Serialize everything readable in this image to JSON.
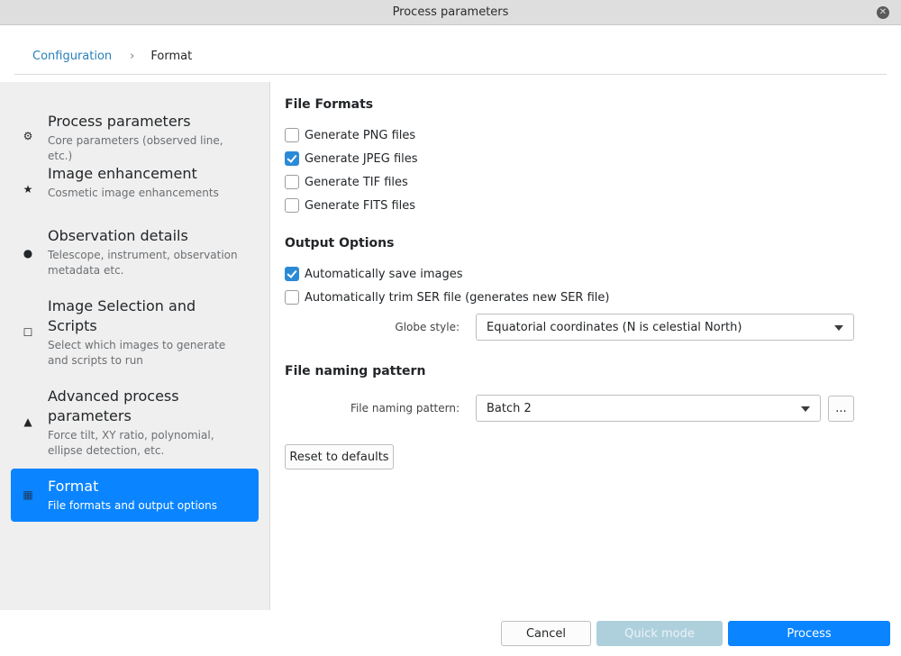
{
  "window": {
    "title": "Process parameters"
  },
  "breadcrumb": {
    "link": "Configuration",
    "separator": "›",
    "current": "Format"
  },
  "sidebar": {
    "items": [
      {
        "icon": "⚙",
        "label": "Process parameters",
        "desc": "Core parameters (observed line, etc.)"
      },
      {
        "icon": "★",
        "label": "Image enhancement",
        "desc": "Cosmetic image enhancements"
      },
      {
        "icon": "●",
        "label": "Observation details",
        "desc": "Telescope, instrument, observation metadata etc."
      },
      {
        "icon": "☐",
        "label": "Image Selection and Scripts",
        "desc": "Select which images to generate and scripts to run"
      },
      {
        "icon": "▲",
        "label": "Advanced process parameters",
        "desc": "Force tilt, XY ratio, polynomial, ellipse detection, etc."
      },
      {
        "icon": "▦",
        "label": "Format",
        "desc": "File formats and output options",
        "active": true
      }
    ]
  },
  "file_formats": {
    "title": "File Formats",
    "options": [
      {
        "label": "Generate PNG files",
        "checked": false
      },
      {
        "label": "Generate JPEG files",
        "checked": true
      },
      {
        "label": "Generate TIF files",
        "checked": false
      },
      {
        "label": "Generate FITS files",
        "checked": false
      }
    ]
  },
  "output_options": {
    "title": "Output Options",
    "options": [
      {
        "label": "Automatically save images",
        "checked": true
      },
      {
        "label": "Automatically trim SER file (generates new SER file)",
        "checked": false
      }
    ],
    "globe_label": "Globe style:",
    "globe_value": "Equatorial coordinates (N is celestial North)"
  },
  "naming": {
    "title": "File naming pattern",
    "label": "File naming pattern:",
    "value": "Batch 2",
    "more_label": "..."
  },
  "reset_label": "Reset to defaults",
  "footer": {
    "cancel": "Cancel",
    "quick": "Quick mode",
    "process": "Process"
  },
  "colors": {
    "accent": "#0a84ff",
    "disabled": "#aed0dd",
    "link": "#2980b9"
  }
}
